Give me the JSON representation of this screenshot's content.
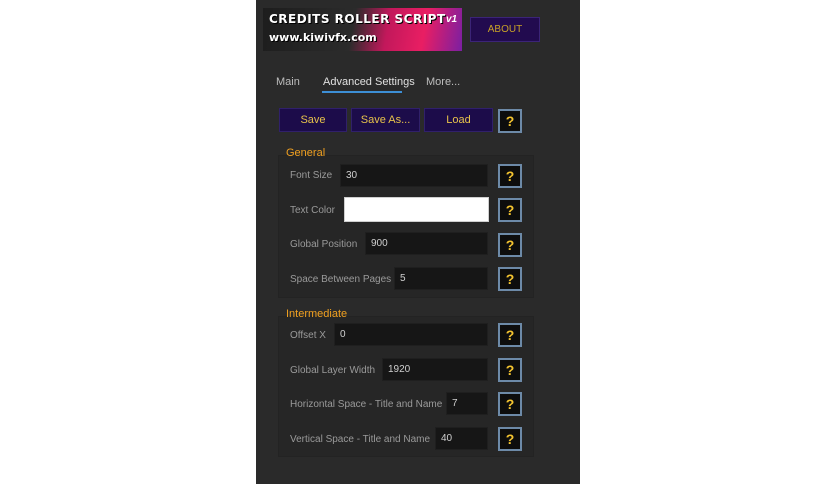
{
  "header": {
    "banner_title": "CREDITS ROLLER SCRIPT",
    "banner_version": "v1",
    "banner_url": "www.kiwivfx.com",
    "about_label": "ABOUT"
  },
  "tabs": [
    {
      "label": "Main"
    },
    {
      "label": "Advanced Settings"
    },
    {
      "label": "More..."
    }
  ],
  "toolbar": {
    "save_label": "Save",
    "save_as_label": "Save As...",
    "load_label": "Load",
    "help_label": "?"
  },
  "general": {
    "title": "General",
    "fields": [
      {
        "label": "Font Size",
        "value": "30"
      },
      {
        "label": "Text Color",
        "value": ""
      },
      {
        "label": "Global Position",
        "value": "900"
      },
      {
        "label": "Space Between Pages",
        "value": "5"
      }
    ]
  },
  "intermediate": {
    "title": "Intermediate",
    "fields": [
      {
        "label": "Offset X",
        "value": "0"
      },
      {
        "label": "Global Layer Width",
        "value": "1920"
      },
      {
        "label": "Horizontal Space - Title and Name",
        "value": "7"
      },
      {
        "label": "Vertical Space - Title and Name",
        "value": "40"
      }
    ]
  },
  "colors": {
    "panel_bg": "#2a2a2a",
    "button_bg": "#1c0c4a",
    "button_text": "#e7c24b",
    "section_title": "#f0a020",
    "tab_active_underline": "#3d8fd6",
    "text_color_swatch": "#ffffff"
  }
}
